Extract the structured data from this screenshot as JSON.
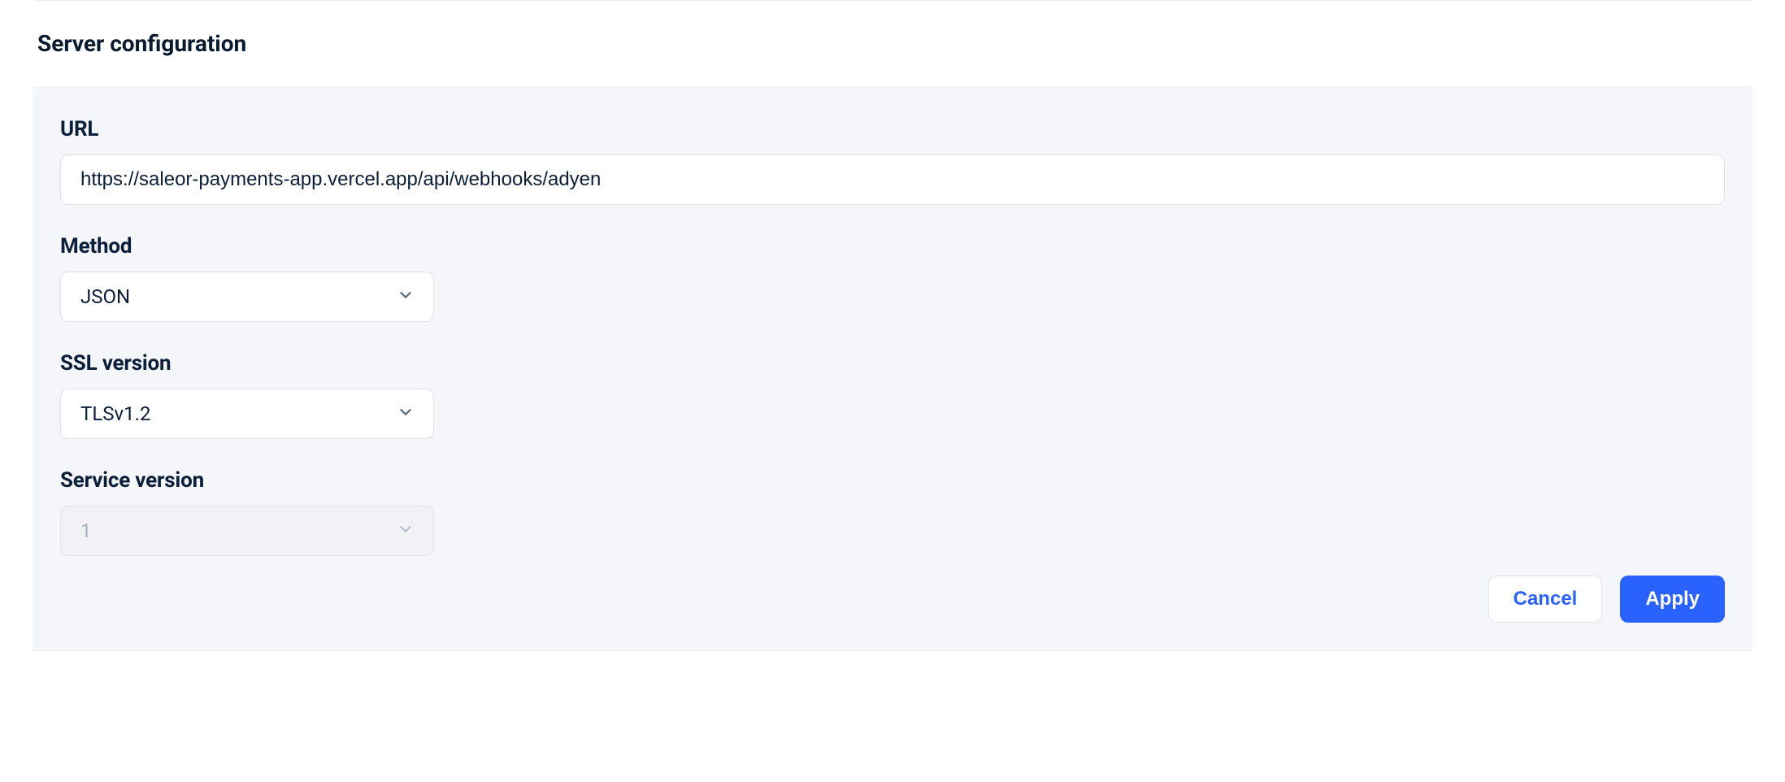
{
  "section": {
    "title": "Server configuration"
  },
  "fields": {
    "url": {
      "label": "URL",
      "value": "https://saleor-payments-app.vercel.app/api/webhooks/adyen"
    },
    "method": {
      "label": "Method",
      "value": "JSON"
    },
    "ssl_version": {
      "label": "SSL version",
      "value": "TLSv1.2"
    },
    "service_version": {
      "label": "Service version",
      "value": "1"
    }
  },
  "buttons": {
    "cancel": "Cancel",
    "apply": "Apply"
  }
}
